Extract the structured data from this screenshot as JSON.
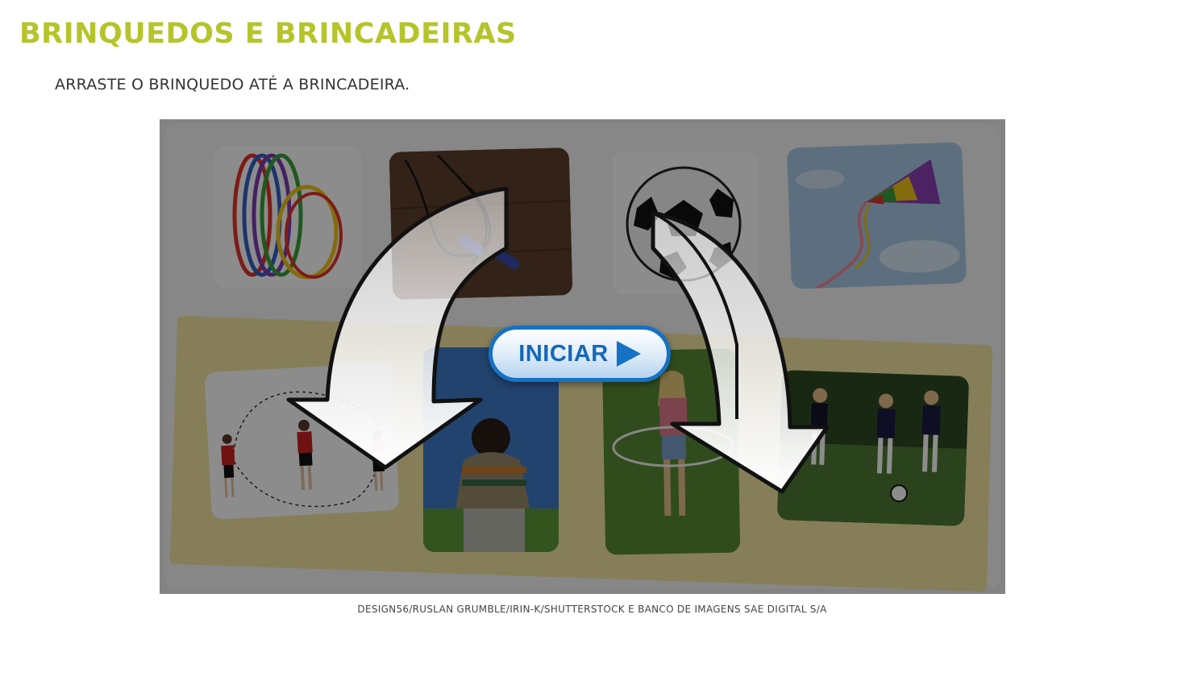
{
  "page": {
    "title": "BRINQUEDOS E BRINCADEIRAS",
    "instruction": "ARRASTE O BRINQUEDO ATÉ A BRINCADEIRA.",
    "credit": "DESIGN56/RUSLAN GRUMBLE/IRIN-K/SHUTTERSTOCK E BANCO DE IMAGENS SAE DIGITAL S/A"
  },
  "activity": {
    "start_label": "INICIAR",
    "toys": [
      "hula-hoops",
      "jump-rope",
      "soccer-ball",
      "kite"
    ],
    "activities": [
      "jumping-rope",
      "flying-kite",
      "hula-hoop",
      "playing-soccer"
    ]
  },
  "colors": {
    "title": "#b5c42b",
    "button_border": "#1572c4",
    "tray": "#f3e6a2"
  }
}
